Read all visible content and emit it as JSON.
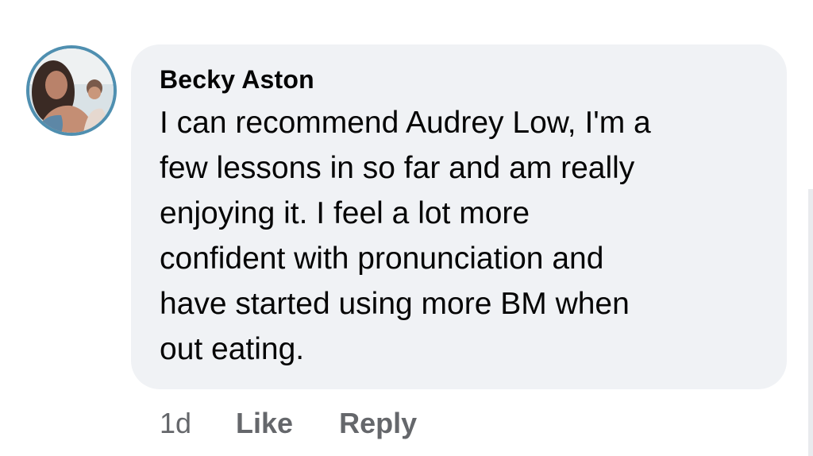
{
  "comment": {
    "author": "Becky Aston",
    "text_lines": [
      "I can recommend Audrey Low, I'm a",
      "few lessons in so far and am really",
      "enjoying it. I feel a lot more",
      "confident with pronunciation and",
      "have started using more BM when",
      "out eating."
    ],
    "time": "1d",
    "like_label": "Like",
    "reply_label": "Reply"
  },
  "colors": {
    "bubble": "#f0f2f5",
    "text": "#050505",
    "meta": "#65676b",
    "avatar_ring": "#4f8fb0"
  },
  "icons": {
    "avatar": "profile-photo"
  }
}
